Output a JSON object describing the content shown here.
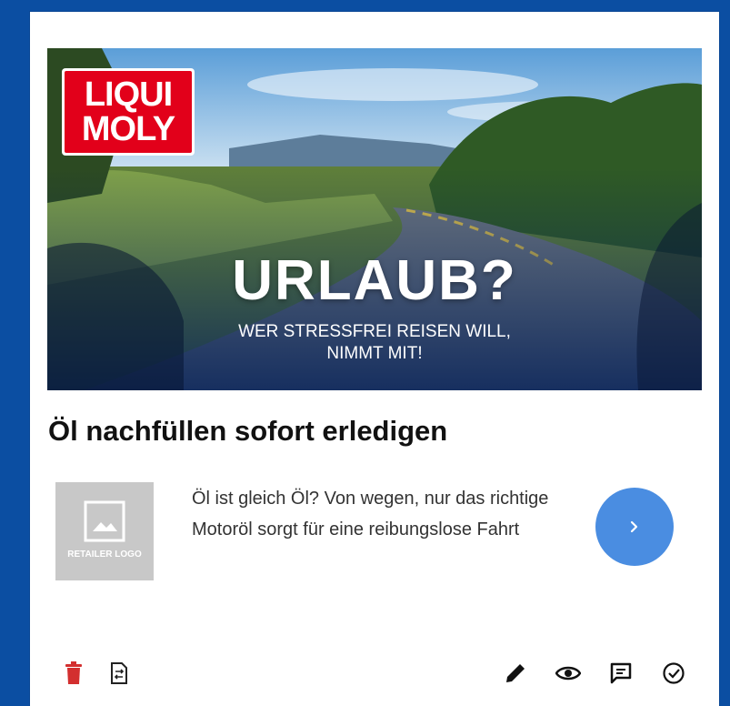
{
  "ad": {
    "brand_line1": "LIQUI",
    "brand_line2": "MOLY",
    "headline": "URLAUB?",
    "subline1": "WER STRESSFREI REISEN WILL,",
    "subline2": "NIMMT MIT!",
    "title": "Öl nachfüllen sofort erledigen",
    "description": "Öl ist gleich Öl? Von wegen, nur das richtige Motoröl sorgt für eine reibungslose Fahrt",
    "retailer_logo_label": "RETAILER LOGO",
    "cta_icon": "chevron-right-icon"
  },
  "toolbar": {
    "left": [
      "trash-icon",
      "swap-document-icon"
    ],
    "right": [
      "edit-pencil-icon",
      "eye-icon",
      "comment-icon",
      "check-circle-icon"
    ]
  },
  "colors": {
    "background": "#0b4ea2",
    "brand_red": "#e2001a",
    "cta_blue": "#4a8de1",
    "delete_red": "#d32f2f"
  }
}
